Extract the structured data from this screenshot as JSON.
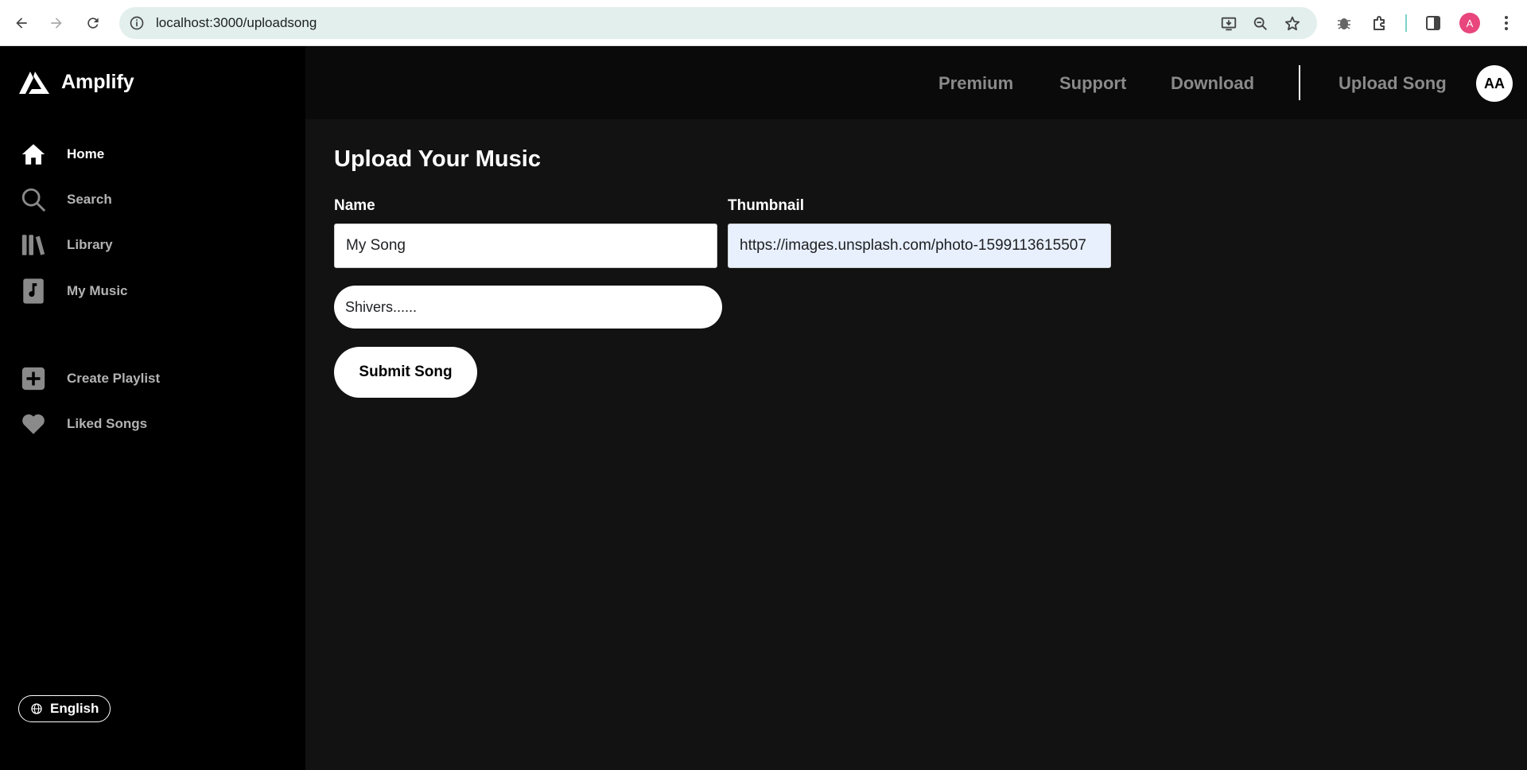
{
  "browser": {
    "url": "localhost:3000/uploadsong",
    "profile_initial": "A"
  },
  "sidebar": {
    "brand": "Amplify",
    "items": [
      {
        "label": "Home",
        "icon": "home-icon",
        "active": true
      },
      {
        "label": "Search",
        "icon": "search-icon",
        "active": false
      },
      {
        "label": "Library",
        "icon": "library-icon",
        "active": false
      },
      {
        "label": "My Music",
        "icon": "music-note-icon",
        "active": false
      }
    ],
    "actions": [
      {
        "label": "Create Playlist",
        "icon": "plus-square-icon"
      },
      {
        "label": "Liked Songs",
        "icon": "heart-icon"
      }
    ],
    "language": "English"
  },
  "header": {
    "links": [
      "Premium",
      "Support",
      "Download"
    ],
    "upload": "Upload Song",
    "avatar": "AA"
  },
  "form": {
    "title": "Upload Your Music",
    "name_label": "Name",
    "name_value": "My Song",
    "thumbnail_label": "Thumbnail",
    "thumbnail_value": "https://images.unsplash.com/photo-1599113615507",
    "track_value": "Shivers......",
    "submit": "Submit Song"
  },
  "colors": {
    "sidebar_bg": "#000000",
    "main_bg": "#121212",
    "header_bg": "#0a0a0a",
    "muted_text": "#b3b3b3"
  }
}
